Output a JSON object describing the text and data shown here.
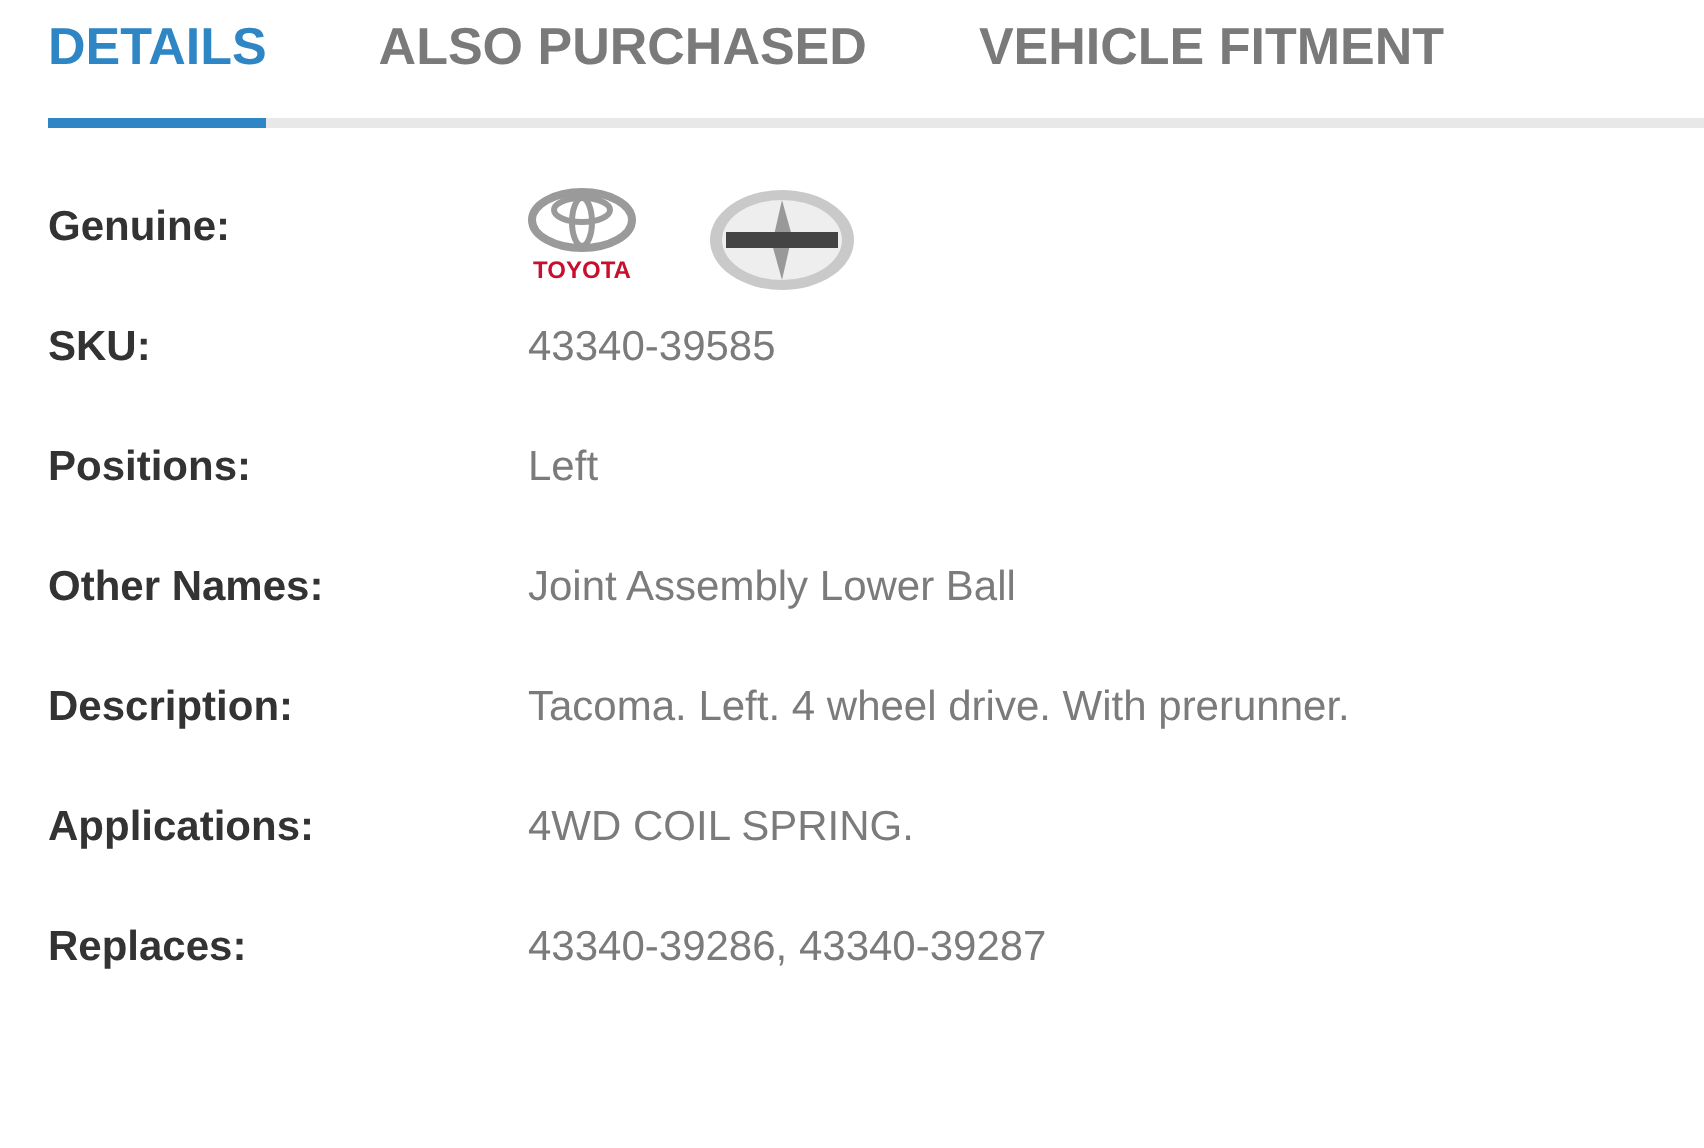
{
  "tabs": [
    {
      "label": "DETAILS",
      "selected": true
    },
    {
      "label": "ALSO PURCHASED",
      "selected": false
    },
    {
      "label": "VEHICLE FITMENT",
      "selected": false
    }
  ],
  "details": [
    {
      "label": "Genuine:",
      "kind": "brands",
      "brands": [
        {
          "kind": "toyota",
          "name": "TOYOTA"
        },
        {
          "kind": "scion"
        }
      ]
    },
    {
      "label": "SKU:",
      "kind": "text",
      "value": "43340-39585"
    },
    {
      "label": "Positions:",
      "kind": "text",
      "value": "Left"
    },
    {
      "label": "Other Names:",
      "kind": "text",
      "value": "Joint Assembly Lower Ball"
    },
    {
      "label": "Description:",
      "kind": "text",
      "value": "Tacoma. Left. 4 wheel drive. With prerunner."
    },
    {
      "label": "Applications:",
      "kind": "text",
      "value": "4WD COIL SPRING."
    },
    {
      "label": "Replaces:",
      "kind": "text",
      "value": "43340-39286, 43340-39287"
    }
  ]
}
